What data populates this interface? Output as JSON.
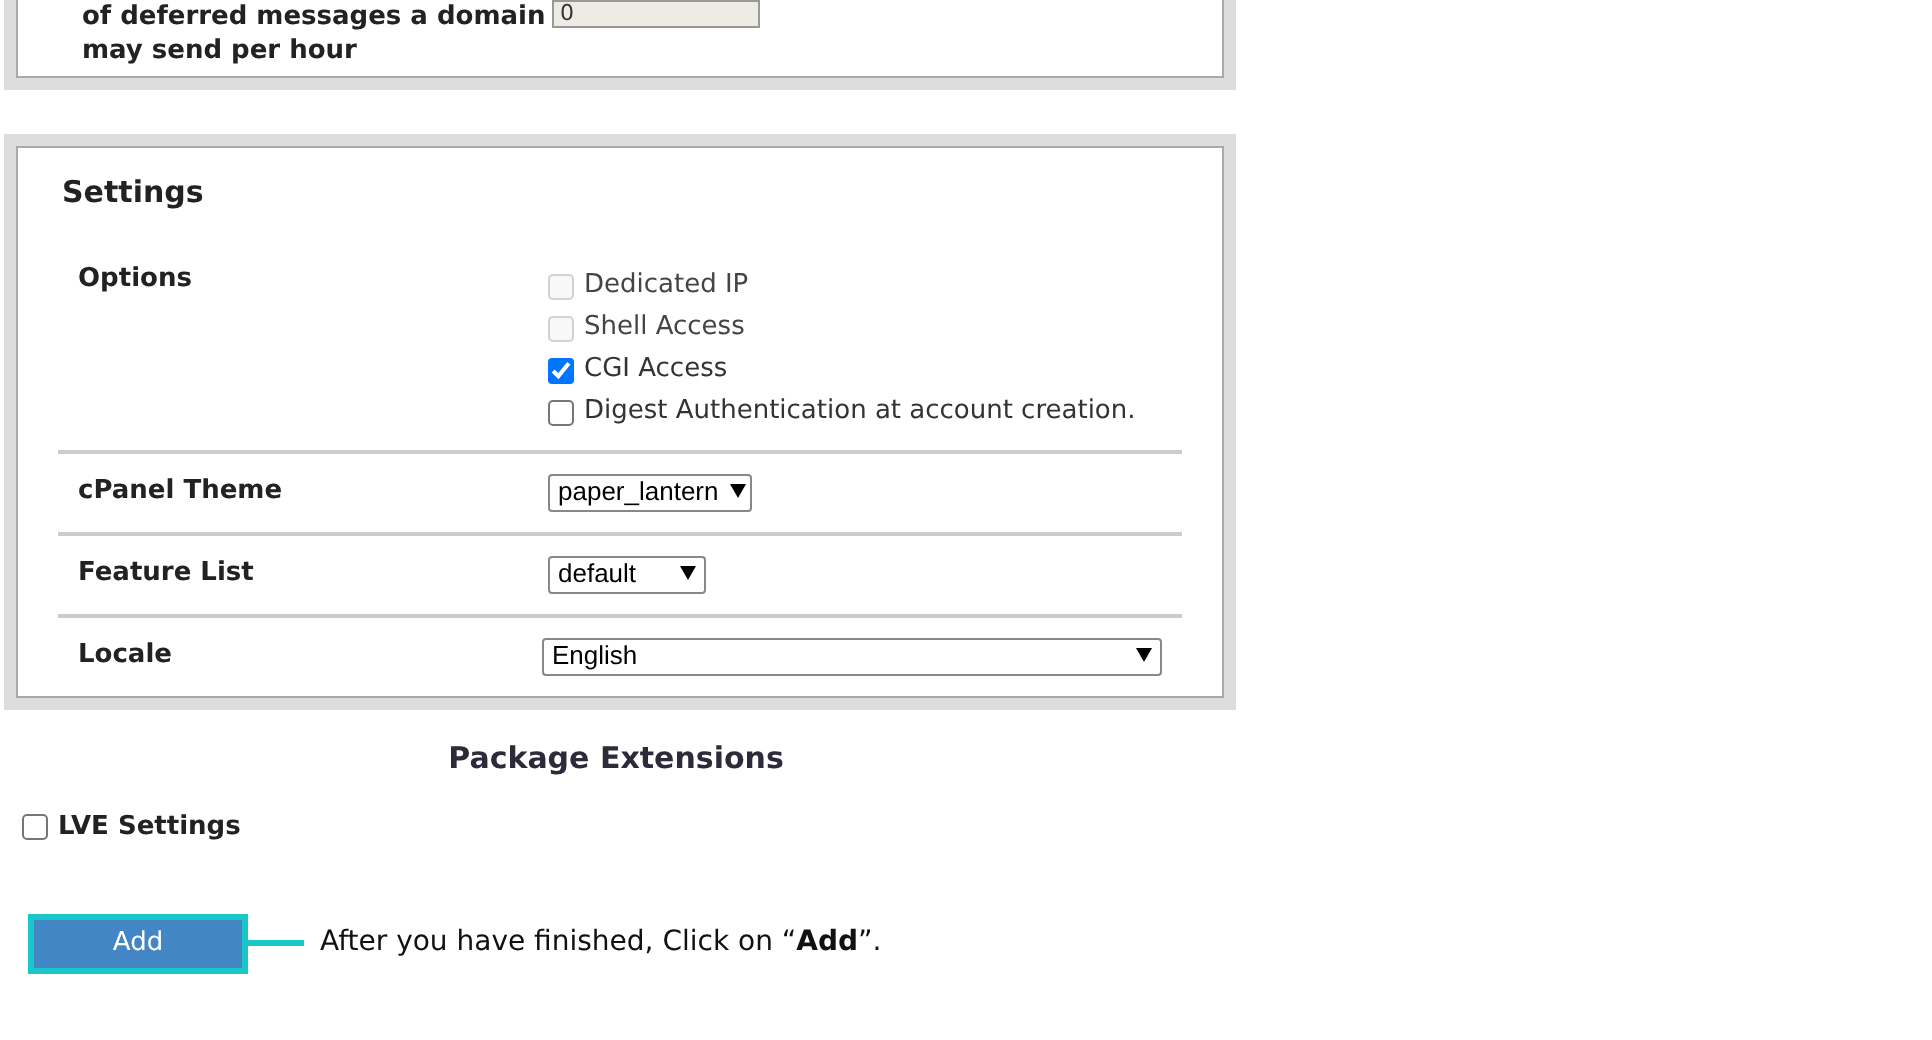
{
  "limits_panel": {
    "label": "of deferred messages a domain may send per hour",
    "value": "0"
  },
  "settings": {
    "title": "Settings",
    "options": {
      "label": "Options",
      "items": [
        {
          "label": "Dedicated IP",
          "checked": false,
          "disabled": true
        },
        {
          "label": "Shell Access",
          "checked": false,
          "disabled": true
        },
        {
          "label": "CGI Access",
          "checked": true,
          "disabled": false
        },
        {
          "label": "Digest Authentication at account creation.",
          "checked": false,
          "disabled": false
        }
      ]
    },
    "selects": [
      {
        "label": "cPanel Theme",
        "value": "paper_lantern"
      },
      {
        "label": "Feature List",
        "value": "default"
      },
      {
        "label": "Locale",
        "value": "English"
      }
    ]
  },
  "extensions": {
    "title": "Package Extensions",
    "items": [
      {
        "label": "LVE Settings",
        "checked": false
      }
    ]
  },
  "add_button": {
    "label": "Add"
  },
  "callout": "After you have finished, Click on “**Add**”."
}
